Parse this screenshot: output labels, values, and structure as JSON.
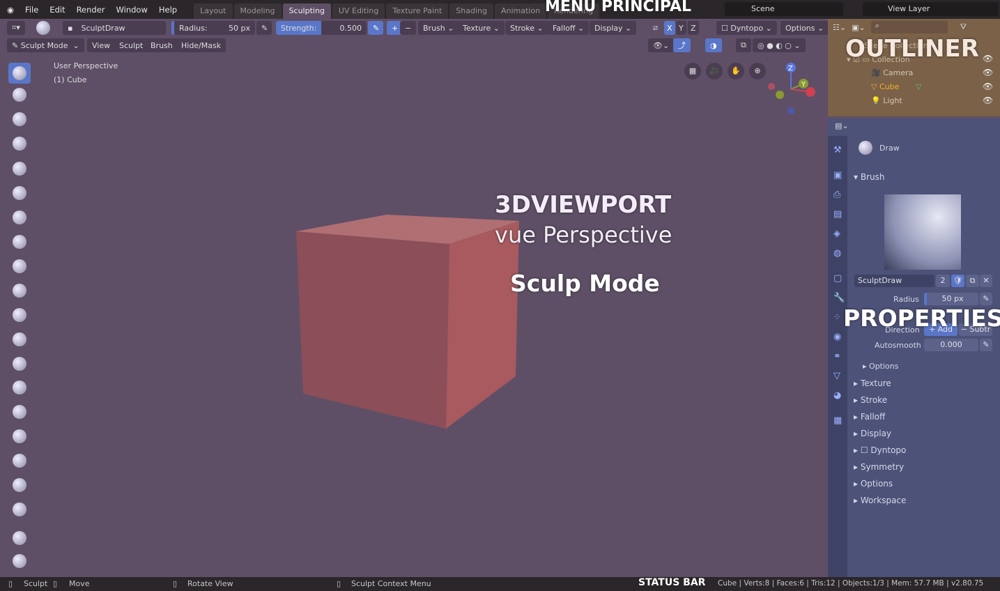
{
  "menu": [
    "File",
    "Edit",
    "Render",
    "Window",
    "Help"
  ],
  "workspaces": [
    "Layout",
    "Modeling",
    "Sculpting",
    "UV Editing",
    "Texture Paint",
    "Shading",
    "Animation",
    "Rendering"
  ],
  "active_workspace": "Sculpting",
  "scene": "Scene",
  "view_layer": "View Layer",
  "header": {
    "brush_name": "SculptDraw",
    "radius_label": "Radius:",
    "radius_value": "50 px",
    "strength_label": "Strength:",
    "strength_value": "0.500",
    "strength_fraction": 0.5,
    "plus": "+",
    "minus": "−",
    "dropdowns": [
      "Brush",
      "Texture",
      "Stroke",
      "Falloff",
      "Display"
    ],
    "axes": [
      "X",
      "Y",
      "Z"
    ],
    "dyntopo": "Dyntopo",
    "options": "Options"
  },
  "mode_row": {
    "mode": "Sculpt Mode",
    "menus": [
      "View",
      "Sculpt",
      "Brush",
      "Hide/Mask"
    ]
  },
  "viewport": {
    "view_name": "User Perspective",
    "object": "(1) Cube",
    "gizmo": {
      "z": "Z",
      "y": "Y"
    }
  },
  "outliner": {
    "scene_collection": "Scene Collection",
    "items": [
      {
        "label": "Collection"
      },
      {
        "label": "Camera"
      },
      {
        "label": "Cube",
        "selected": true
      },
      {
        "label": "Light"
      }
    ]
  },
  "properties": {
    "tool": "Draw",
    "brush_panel": "Brush",
    "brush_name": "SculptDraw",
    "users": "2",
    "radius_label": "Radius",
    "radius_value": "50 px",
    "direction_label": "Direction",
    "add": "+ Add",
    "subtract": "− Subtr",
    "autosmooth_label": "Autosmooth",
    "autosmooth_value": "0.000",
    "options_sub": "Options",
    "panels": [
      "Texture",
      "Stroke",
      "Falloff",
      "Display",
      "Dyntopo",
      "Symmetry",
      "Options",
      "Workspace"
    ]
  },
  "status": {
    "sculpt": "Sculpt",
    "move": "Move",
    "rotate": "Rotate View",
    "context": "Sculpt Context Menu",
    "stats": "Cube | Verts:8 | Faces:6 | Tris:12 | Objects:1/3 | Mem: 57.7 MB | v2.80.75"
  },
  "annotations": {
    "menu": "MENU PRINCIPAL",
    "outliner": "OUTLINER",
    "viewport": "3DVIEWPORT",
    "perspective": "vue Perspective",
    "mode": "Sculp Mode",
    "properties": "PROPERTIES",
    "status": "STATUS BAR"
  },
  "colors": {
    "accent": "#5a76c8",
    "viewport_bg": "#5e4f66",
    "cube": "#b5605f",
    "selected": "#f0b030"
  }
}
